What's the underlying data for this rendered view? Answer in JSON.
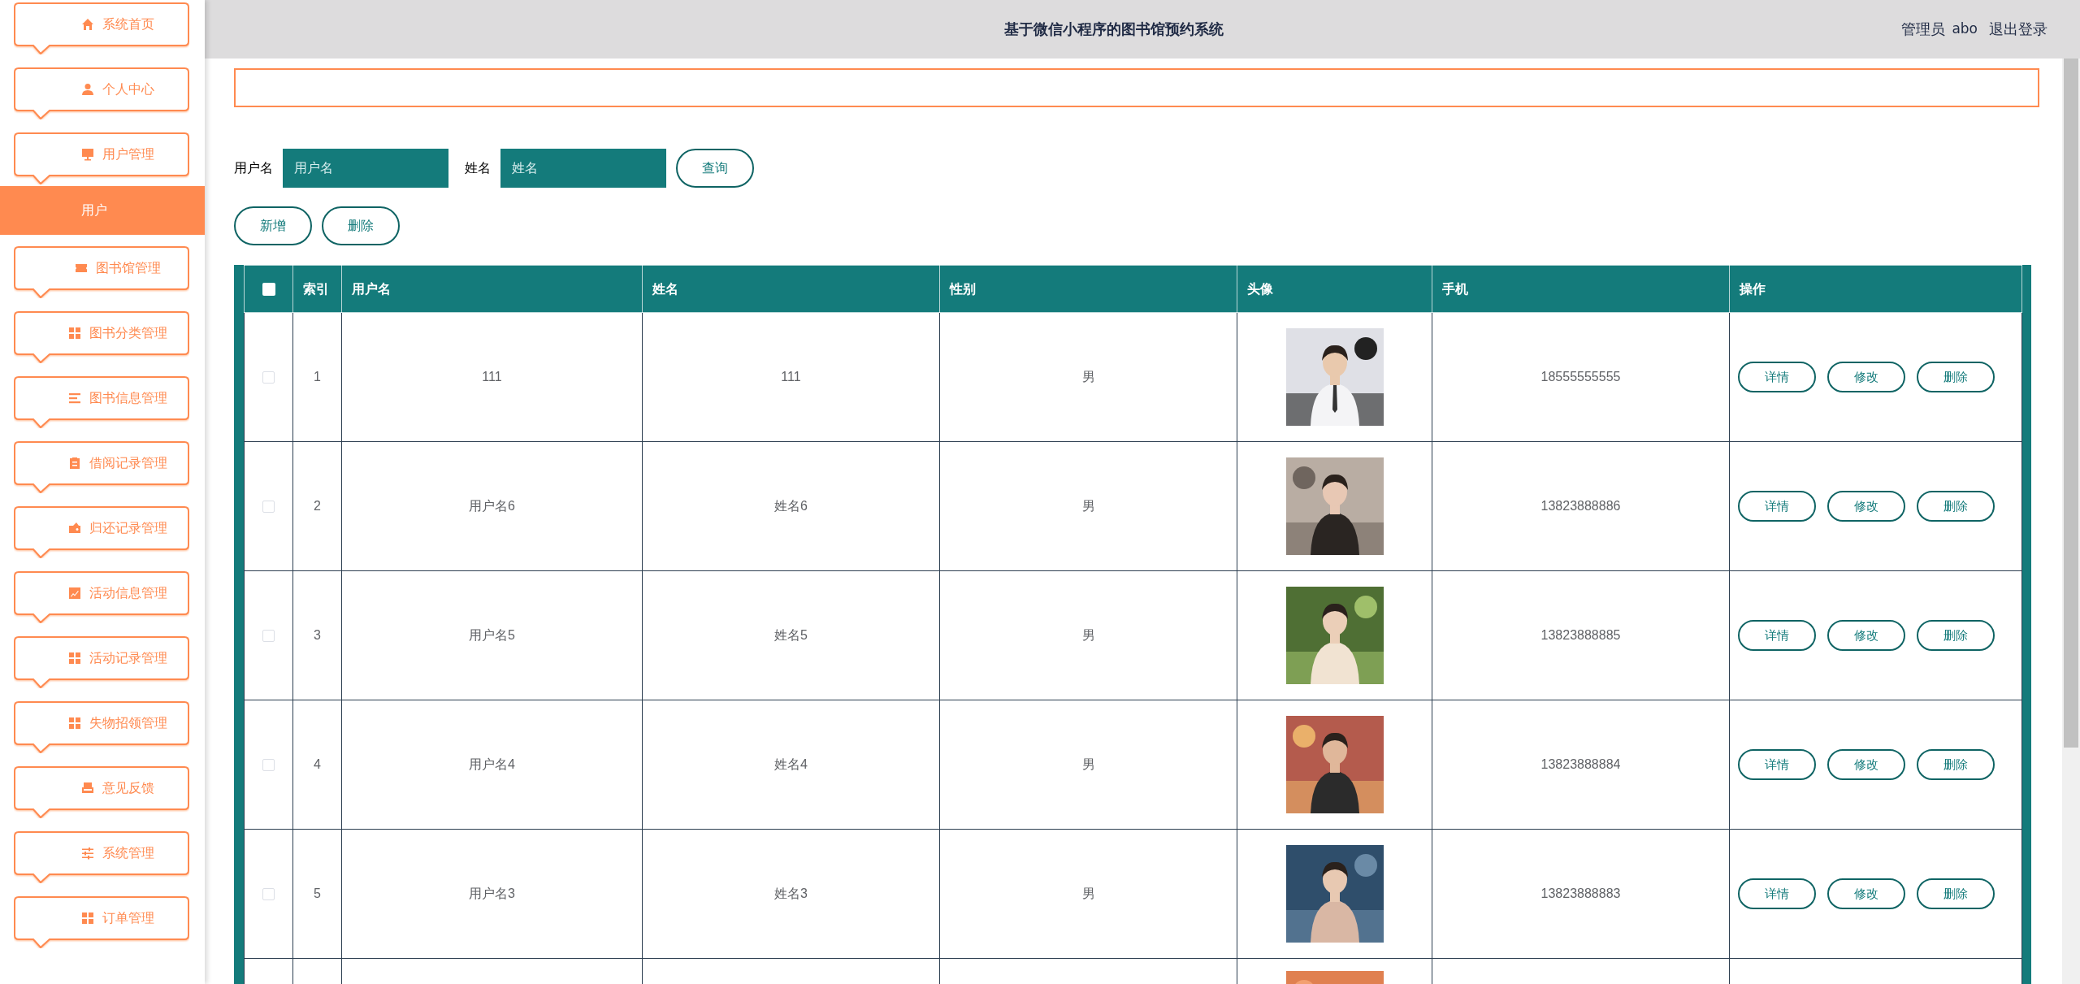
{
  "sidebar": {
    "items": [
      {
        "label": "系统首页"
      },
      {
        "label": "个人中心"
      },
      {
        "label": "用户管理",
        "children": [
          {
            "label": "用户",
            "selected": true
          }
        ]
      },
      {
        "label": "图书馆管理"
      },
      {
        "label": "图书分类管理"
      },
      {
        "label": "图书信息管理"
      },
      {
        "label": "借阅记录管理"
      },
      {
        "label": "归还记录管理"
      },
      {
        "label": "活动信息管理"
      },
      {
        "label": "活动记录管理"
      },
      {
        "label": "失物招领管理"
      },
      {
        "label": "意见反馈"
      },
      {
        "label": "系统管理"
      },
      {
        "label": "订单管理"
      }
    ]
  },
  "header": {
    "title": "基于微信小程序的图书馆预约系统",
    "role": "管理员",
    "username": "abo",
    "logout": "退出登录"
  },
  "search": {
    "fields": [
      {
        "label": "用户名",
        "placeholder": "用户名"
      },
      {
        "label": "姓名",
        "placeholder": "姓名"
      }
    ],
    "button": "查询"
  },
  "actions": [
    "新增",
    "删除"
  ],
  "table": {
    "select_all": {
      "checked": false
    },
    "columns": [
      "索引",
      "用户名",
      "姓名",
      "性别",
      "头像",
      "手机",
      "操作"
    ],
    "rows": [
      {
        "checked": false,
        "index": "1",
        "username": "111",
        "name": "111",
        "gender": "男",
        "phone": "18555555555",
        "actions": [
          "详情",
          "修改",
          "删除"
        ]
      },
      {
        "checked": false,
        "index": "2",
        "username": "用户名6",
        "name": "姓名6",
        "gender": "男",
        "phone": "13823888886",
        "actions": [
          "详情",
          "修改",
          "删除"
        ]
      },
      {
        "checked": false,
        "index": "3",
        "username": "用户名5",
        "name": "姓名5",
        "gender": "男",
        "phone": "13823888885",
        "actions": [
          "详情",
          "修改",
          "删除"
        ]
      },
      {
        "checked": false,
        "index": "4",
        "username": "用户名4",
        "name": "姓名4",
        "gender": "男",
        "phone": "13823888884",
        "actions": [
          "详情",
          "修改",
          "删除"
        ]
      },
      {
        "checked": false,
        "index": "5",
        "username": "用户名3",
        "name": "姓名3",
        "gender": "男",
        "phone": "13823888883",
        "actions": [
          "详情",
          "修改",
          "删除"
        ]
      }
    ]
  }
}
